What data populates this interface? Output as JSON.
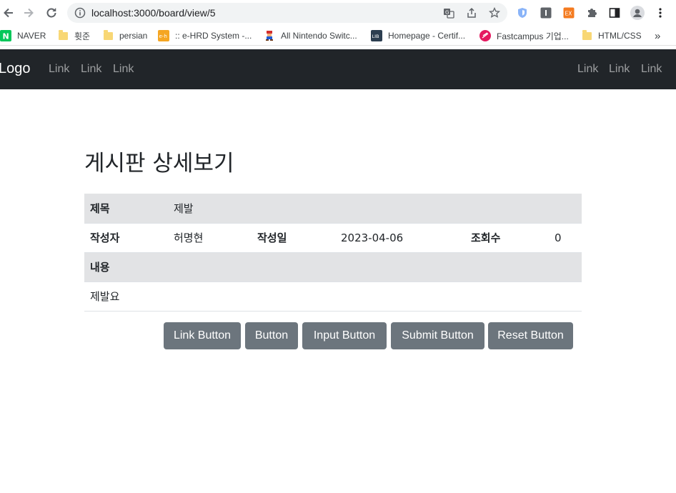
{
  "browser": {
    "url": "localhost:3000/board/view/5",
    "bookmarks": [
      {
        "label": "NAVER",
        "icon": "naver-icon"
      },
      {
        "label": "휫준",
        "icon": "folder-icon"
      },
      {
        "label": "persian",
        "icon": "folder-icon"
      },
      {
        "label": ":: e-HRD System -...",
        "icon": "ehrd-icon"
      },
      {
        "label": "All Nintendo Switc...",
        "icon": "mario-icon"
      },
      {
        "label": "Homepage - Certif...",
        "icon": "libre-icon"
      },
      {
        "label": "Fastcampus 기업...",
        "icon": "fastcampus-icon"
      },
      {
        "label": "HTML/CSS",
        "icon": "folder-icon"
      }
    ],
    "more_label": "»"
  },
  "navbar": {
    "brand": "Logo",
    "left_links": [
      "Link",
      "Link",
      "Link"
    ],
    "right_links": [
      "Link",
      "Link",
      "Link"
    ]
  },
  "page": {
    "title": "게시판 상세보기",
    "subject_label": "제목",
    "subject_value": "제발",
    "author_label": "작성자",
    "author_value": "허명현",
    "date_label": "작성일",
    "date_value": "2023-04-06",
    "views_label": "조회수",
    "views_value": "0",
    "content_label": "내용",
    "content_value": "제발요"
  },
  "buttons": {
    "link": "Link Button",
    "button": "Button",
    "input": "Input Button",
    "submit": "Submit Button",
    "reset": "Reset Button"
  },
  "colors": {
    "navbar_bg": "#212529",
    "row_shade": "#e2e3e5",
    "button_bg": "#6c757d"
  }
}
